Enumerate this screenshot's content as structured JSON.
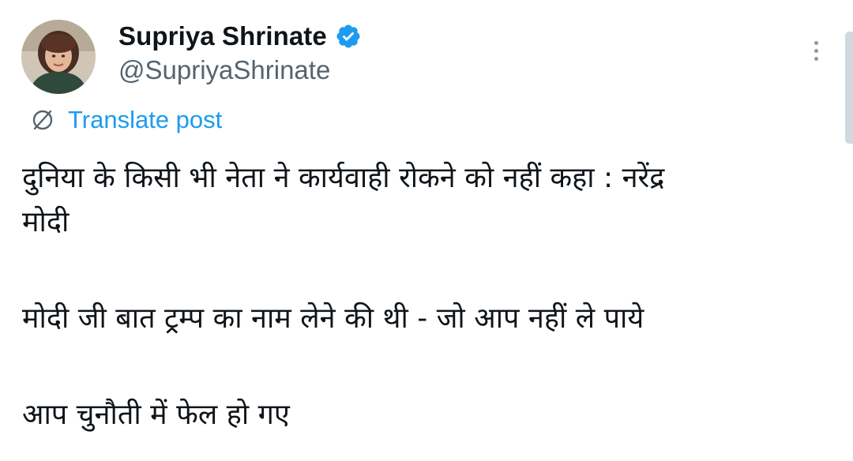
{
  "author": {
    "name": "Supriya Shrinate",
    "handle": "@SupriyaShrinate",
    "verified": true,
    "verified_color": "#1d9bf0"
  },
  "actions": {
    "more_icon": "more-vertical-icon",
    "translate_label": "Translate post",
    "translate_icon": "globe-icon"
  },
  "post": {
    "line1": "दुनिया के किसी भी नेता ने कार्यवाही रोकने को नहीं कहा : नरेंद्र",
    "line2": "मोदी",
    "line3": "मोदी जी बात ट्रम्प का नाम लेने की थी - जो आप नहीं ले पाये",
    "line4": "आप चुनौती में फेल हो गए"
  },
  "colors": {
    "text": "#0f1419",
    "secondary": "#536471",
    "link": "#1d9bf0"
  }
}
